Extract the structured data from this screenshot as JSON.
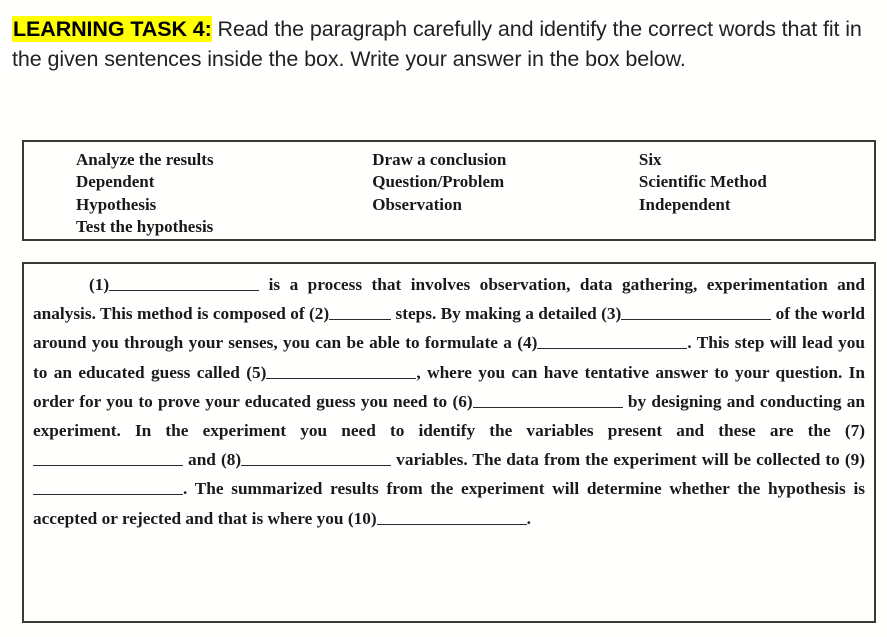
{
  "instruction": {
    "task_label": "LEARNING TASK 4:",
    "highlight_color": "#ffff00",
    "body": " Read the paragraph carefully and identify the correct words that fit in the given sentences inside the box. Write your answer in the box below."
  },
  "word_bank": {
    "columns": [
      {
        "items": [
          "Analyze the results",
          "Dependent",
          "Hypothesis",
          "Test the hypothesis"
        ]
      },
      {
        "items": [
          "Draw a conclusion",
          "Question/Problem",
          "Observation"
        ]
      },
      {
        "items": [
          "Six",
          "Scientific Method",
          "Independent"
        ]
      }
    ]
  },
  "paragraph": {
    "segments": {
      "s0": "(1)",
      "s1": " is a process that involves observation, data gathering, experimentation and analysis. This method is composed of (2)",
      "s2": " steps.  By making a detailed (3)",
      "s3": " of the world around you through your senses, you can be able to formulate a (4)",
      "s4": ". This step will lead you to an educated guess called (5)",
      "s5": ", where you can have tentative answer to your question. In order for you to prove your educated guess you need to (6)",
      "s6": " by designing and conducting an experiment. In the experiment you need to identify the variables present and these are the (7)",
      "s7": " and (8)",
      "s8": " variables. The data from the experiment will be collected to (9)",
      "s9": ". The summarized results from the experiment will determine whether the hypothesis is accepted or rejected and that is where you (10)",
      "s10": "."
    }
  }
}
